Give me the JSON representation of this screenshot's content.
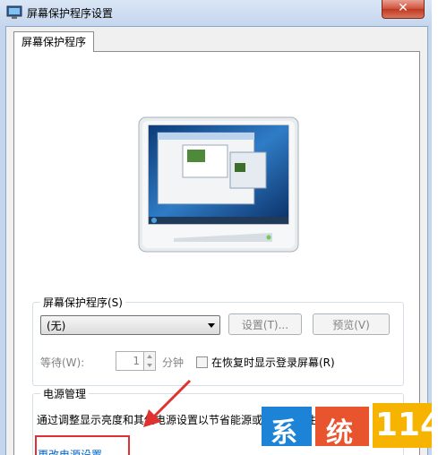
{
  "window": {
    "title": "屏幕保护程序设置",
    "close_glyph": "✕"
  },
  "tab": {
    "label": "屏幕保护程序"
  },
  "screensaver": {
    "group_label": "屏幕保护程序(S)",
    "selected": "(无)",
    "settings_button": "设置(T)...",
    "preview_button": "预览(V)",
    "wait_label": "等待(W):",
    "wait_value": "1",
    "wait_unit": "分钟",
    "resume_checkbox_label": "在恢复时显示登录屏幕(R)",
    "resume_checked": false
  },
  "power": {
    "group_label": "电源管理",
    "description": "通过调整显示亮度和其他电源设置以节省能源或提供最佳性能。",
    "link": "更改电源设置"
  },
  "watermark": {
    "chars": [
      "系",
      "统",
      "114"
    ]
  },
  "colors": {
    "link": "#0066cc",
    "highlight": "#e03030",
    "close": "#c0391f"
  }
}
